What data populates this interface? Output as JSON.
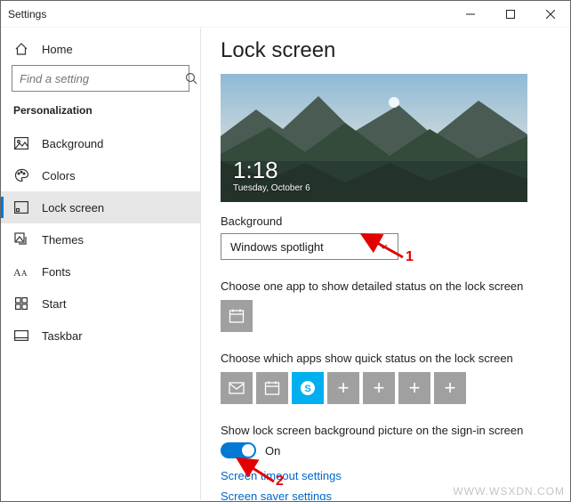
{
  "window": {
    "title": "Settings"
  },
  "sidebar": {
    "home_label": "Home",
    "search_placeholder": "Find a setting",
    "section": "Personalization",
    "items": [
      {
        "label": "Background"
      },
      {
        "label": "Colors"
      },
      {
        "label": "Lock screen"
      },
      {
        "label": "Themes"
      },
      {
        "label": "Fonts"
      },
      {
        "label": "Start"
      },
      {
        "label": "Taskbar"
      }
    ]
  },
  "main": {
    "title": "Lock screen",
    "preview": {
      "time": "1:18",
      "date": "Tuesday, October 6"
    },
    "background_label": "Background",
    "background_value": "Windows spotlight",
    "detailed_status_label": "Choose one app to show detailed status on the lock screen",
    "quick_status_label": "Choose which apps show quick status on the lock screen",
    "signin_label": "Show lock screen background picture on the sign-in screen",
    "toggle_state": "On",
    "link_timeout": "Screen timeout settings",
    "link_saver": "Screen saver settings"
  },
  "annotations": {
    "one": "1",
    "two": "2"
  },
  "watermark": "WWW.WSXDN.COM"
}
